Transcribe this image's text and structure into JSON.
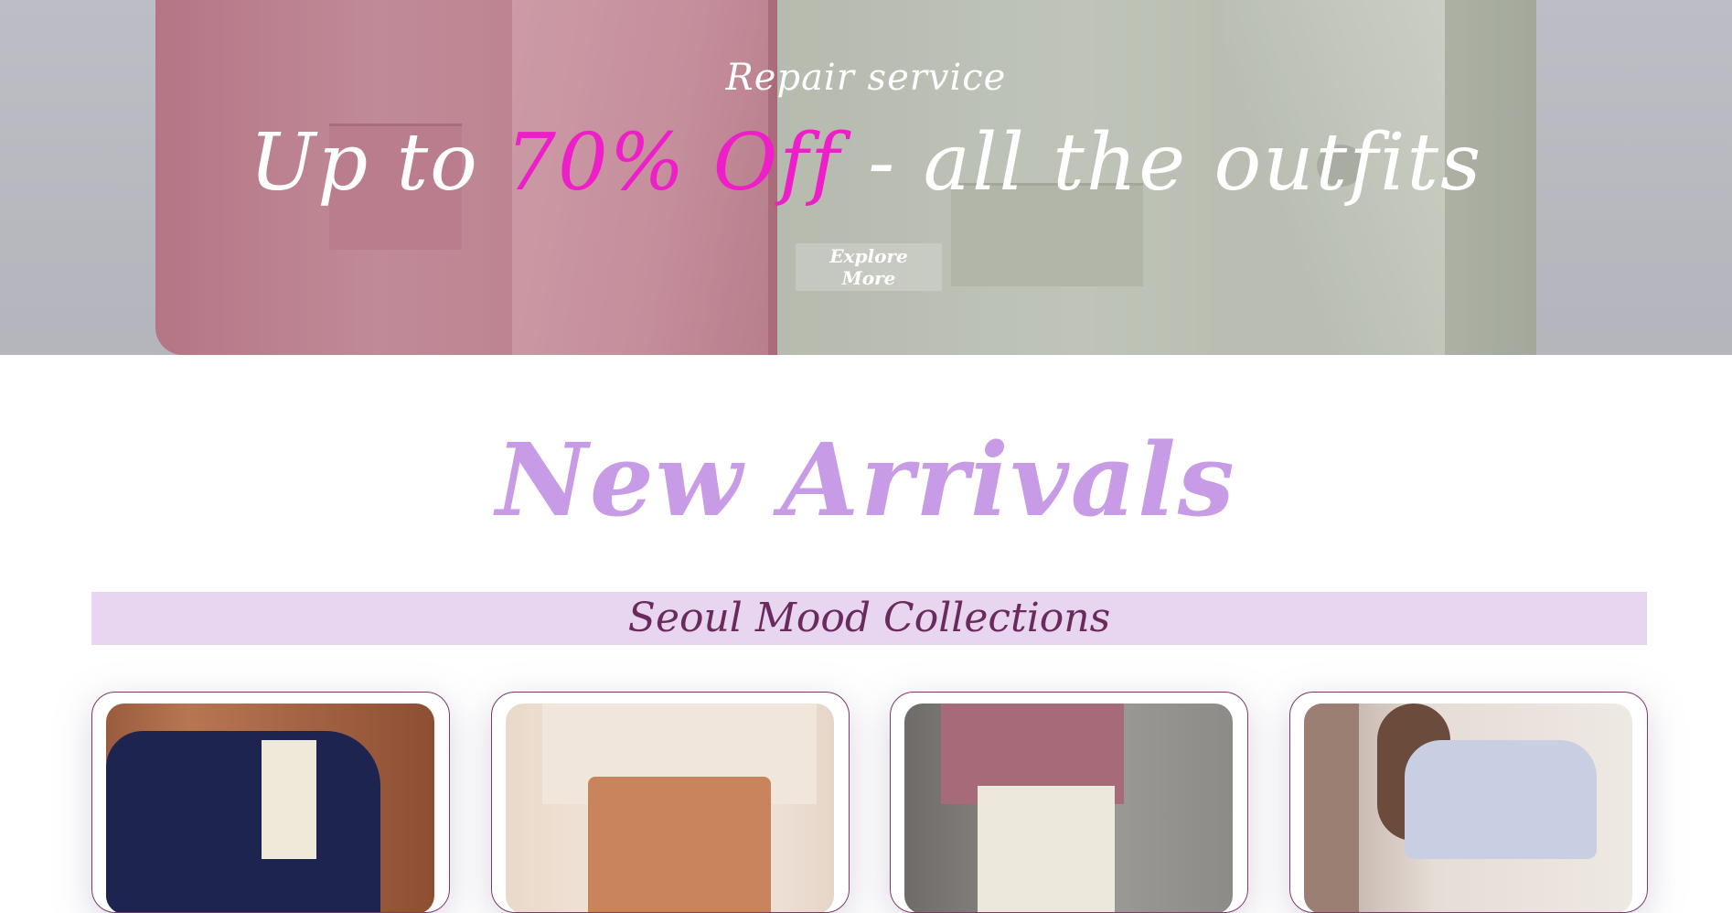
{
  "hero": {
    "subtitle": "Repair service",
    "title_prefix": "Up to ",
    "title_accent": "70% Off",
    "title_suffix": " - all the outfits",
    "cta_label": "Explore More",
    "accent_color": "#ee1ec9"
  },
  "arrivals": {
    "heading": "New Arrivals",
    "heading_color": "#c79be6",
    "collection_label": "Seoul Mood Collections",
    "band_color": "#e8d5ef"
  },
  "products": [
    {
      "image": "navy-cardigan-photo"
    },
    {
      "image": "cream-blouse-tan-skirt-photo"
    },
    {
      "image": "mauve-shirt-white-pants-photo"
    },
    {
      "image": "lavender-knit-polo-photo"
    }
  ]
}
